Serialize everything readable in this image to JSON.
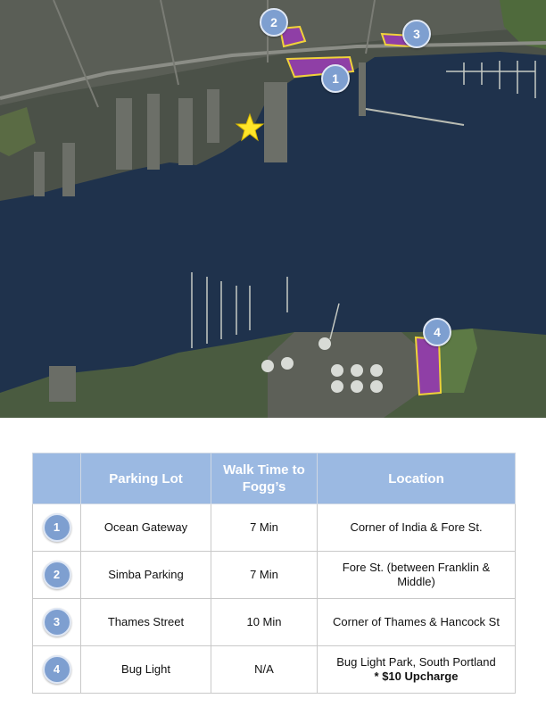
{
  "map": {
    "colors": {
      "water": "#1d2f47",
      "land": "#4a5047",
      "parking_fill": "#8f3fa6",
      "parking_outline": "#f0d23a",
      "marker": "#7e9fd0",
      "star": "#ffe629"
    },
    "markers": [
      "1",
      "2",
      "3",
      "4"
    ],
    "star_icon": "yellow-star"
  },
  "table": {
    "header": {
      "number": "",
      "lot": "Parking Lot",
      "walk": "Walk Time to Fogg’s",
      "location": "Location"
    },
    "rows": [
      {
        "number": "1",
        "lot": "Ocean Gateway",
        "walk": "7 Min",
        "location": "Corner of India & Fore St.",
        "note": ""
      },
      {
        "number": "2",
        "lot": "Simba Parking",
        "walk": "7 Min",
        "location": "Fore St. (between Franklin & Middle)",
        "note": ""
      },
      {
        "number": "3",
        "lot": "Thames Street",
        "walk": "10 Min",
        "location": "Corner of Thames & Hancock St",
        "note": ""
      },
      {
        "number": "4",
        "lot": "Bug Light",
        "walk": "N/A",
        "location": "Bug Light Park, South Portland",
        "note": "* $10 Upcharge"
      }
    ]
  }
}
